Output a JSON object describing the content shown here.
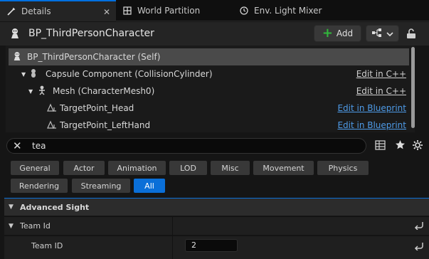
{
  "tabs": [
    {
      "label": "Details",
      "icon": "details-icon",
      "active": true
    },
    {
      "label": "World Partition",
      "icon": "grid-icon",
      "active": false
    },
    {
      "label": "Env. Light Mixer",
      "icon": "light-mixer-icon",
      "active": false
    }
  ],
  "tab_close": "✕",
  "header": {
    "title": "BP_ThirdPersonCharacter",
    "add_label": "Add"
  },
  "tree": {
    "rows": [
      {
        "label": "BP_ThirdPersonCharacter (Self)",
        "link": ""
      },
      {
        "label": "Capsule Component (CollisionCylinder)",
        "link": "Edit in C++"
      },
      {
        "label": "Mesh (CharacterMesh0)",
        "link": "Edit in C++"
      },
      {
        "label": "TargetPoint_Head",
        "link": "Edit in Blueprint"
      },
      {
        "label": "TargetPoint_LeftHand",
        "link": "Edit in Blueprint"
      }
    ]
  },
  "search": {
    "value": "tea"
  },
  "filters": {
    "general": "General",
    "actor": "Actor",
    "animation": "Animation",
    "lod": "LOD",
    "misc": "Misc",
    "movement": "Movement",
    "physics": "Physics",
    "rendering": "Rendering",
    "streaming": "Streaming",
    "all": "All",
    "active": "All"
  },
  "details": {
    "section_title": "Advanced Sight",
    "team_id_group": "Team Id",
    "team_id_label": "Team ID",
    "team_id_value": "2"
  },
  "colors": {
    "accent": "#0a6fd8",
    "link_blue": "#4e9be8",
    "add_green": "#31b73b"
  }
}
